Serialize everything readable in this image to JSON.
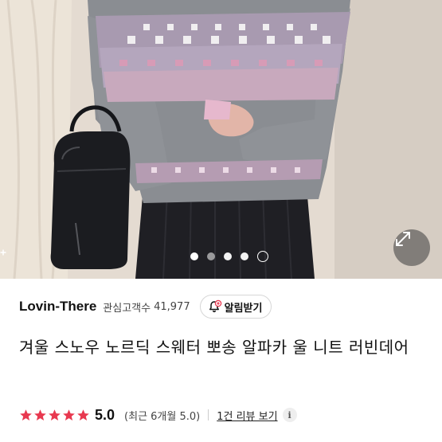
{
  "gallery": {
    "total_dots": 4,
    "active_index": 0
  },
  "seller": {
    "name": "Lovin-There",
    "follower_label": "관심고객수",
    "follower_count": "41,977",
    "notify_label": "알림받기"
  },
  "product": {
    "title": "겨울 스노우 노르딕 스웨터 뽀송 알파카 울 니트 러빈데어"
  },
  "rating": {
    "stars": 5,
    "score": "5.0",
    "recent": "(최근 6개월 5.0)",
    "review_link": "1건 리뷰 보기",
    "star_color": "#e8384f"
  },
  "colors": {
    "accent_red": "#e8384f",
    "text": "#111111"
  }
}
